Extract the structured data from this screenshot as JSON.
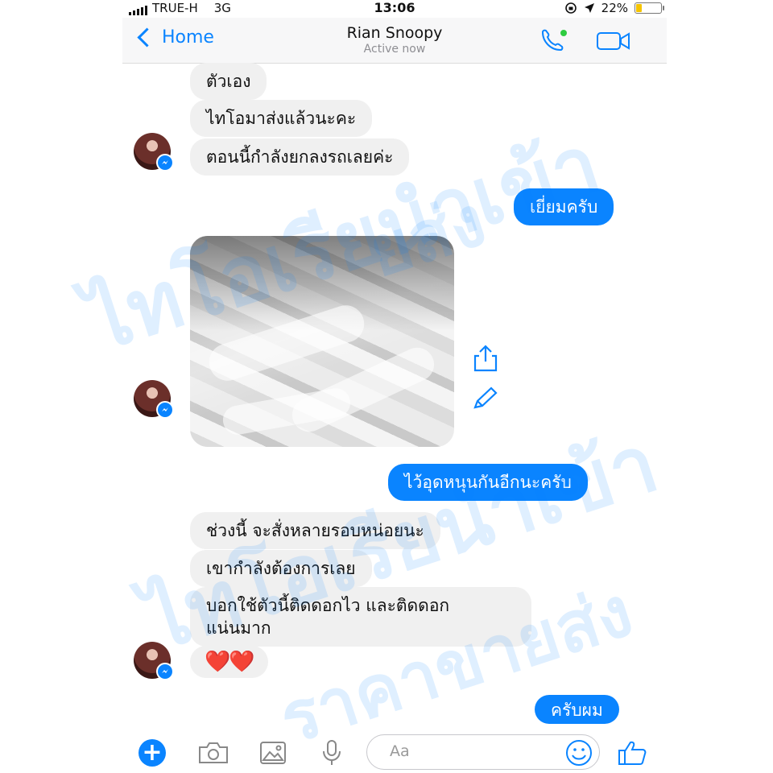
{
  "status_bar": {
    "carrier": "TRUE-H",
    "network": "3G",
    "time": "13:06",
    "battery": "22%",
    "battery_level": 0.22
  },
  "header": {
    "back_label": "Home",
    "contact_name": "Rian Snoopy",
    "contact_status": "Active now",
    "icons": [
      "phone-icon",
      "video-camera-icon"
    ]
  },
  "messages": [
    {
      "side": "in",
      "text": "ตัวเอง"
    },
    {
      "side": "in",
      "text": "ไทโอมาส่งแล้วนะคะ"
    },
    {
      "side": "in",
      "text": "ตอนนี้กำลังยกลงรถเลยค่ะ"
    },
    {
      "side": "out",
      "text": "เยี่ยมครับ"
    },
    {
      "side": "in",
      "type": "photo"
    },
    {
      "side": "out",
      "text": "ไว้อุดหนุนกันอีกนะครับ"
    },
    {
      "side": "in",
      "text": "ช่วงนี้ จะสั่งหลายรอบหน่อยนะ"
    },
    {
      "side": "in",
      "text": "เขากำลังต้องการเลย"
    },
    {
      "side": "in",
      "text_line1": "บอกใช้ตัวนี้ติดดอกไว และติดดอก",
      "text_line2": "แน่นมาก"
    },
    {
      "side": "in",
      "text": "❤️❤️"
    },
    {
      "side": "out",
      "text": "ครับผม"
    }
  ],
  "composer": {
    "placeholder": "Aa",
    "icons": [
      "plus-icon",
      "camera-icon",
      "image-icon",
      "microphone-icon",
      "emoji-icon",
      "thumbs-up-icon"
    ]
  },
  "watermark": {
    "line1": "ไทโอเรียนำเข้า",
    "line2": "ยส่ง",
    "line3": "ไทโอเรียนำเข้า",
    "line4": "ราคาขายส่ง"
  },
  "colors": {
    "accent": "#0a84ff",
    "incoming_bubble": "#f0f0f0",
    "battery": "#f5c400"
  }
}
